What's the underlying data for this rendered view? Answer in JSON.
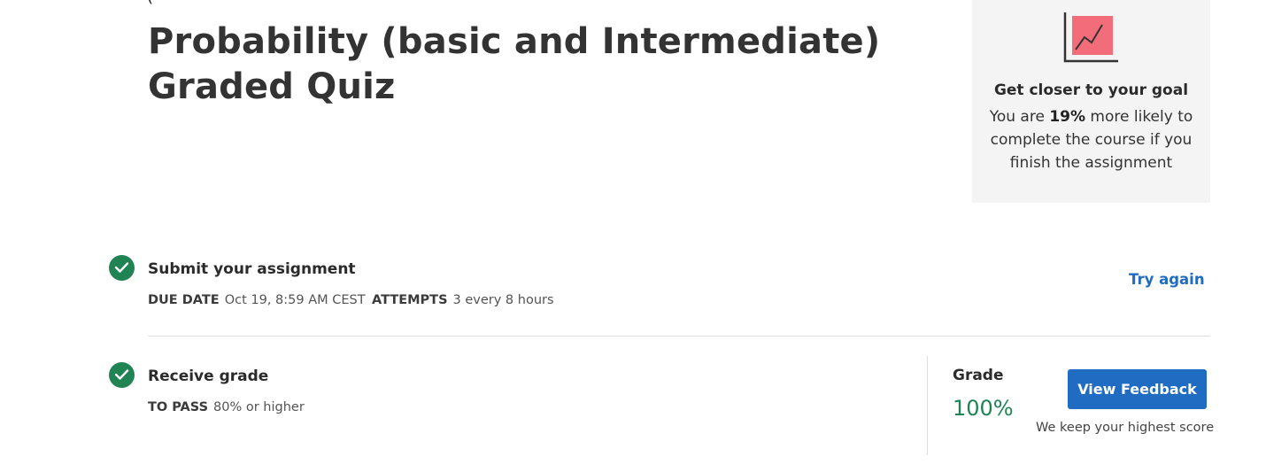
{
  "page": {
    "title": "Probability (basic and Intermediate) Graded Quiz",
    "cut_glyph": "("
  },
  "goal_card": {
    "icon": "line-chart-icon",
    "title": "Get closer to your goal",
    "text_prefix": "You are ",
    "percent": "19%",
    "text_suffix": " more likely to complete the course if you finish the assignment",
    "icon_color": "#f36c7a"
  },
  "submit_step": {
    "icon": "check-circle-icon",
    "title": "Submit your assignment",
    "due_label": "DUE DATE",
    "due_value": "Oct 19, 8:59 AM CEST",
    "attempts_label": "ATTEMPTS",
    "attempts_value": "3 every 8 hours",
    "action_label": "Try again"
  },
  "grade_step": {
    "icon": "check-circle-icon",
    "title": "Receive grade",
    "pass_label": "TO PASS",
    "pass_value": "80% or higher",
    "grade_label": "Grade",
    "grade_value": "100%",
    "button_label": "View Feedback",
    "note": "We keep your highest score"
  },
  "colors": {
    "accent": "#1f6cc2",
    "success": "#1f8354",
    "card_bg": "#f4f4f4"
  }
}
